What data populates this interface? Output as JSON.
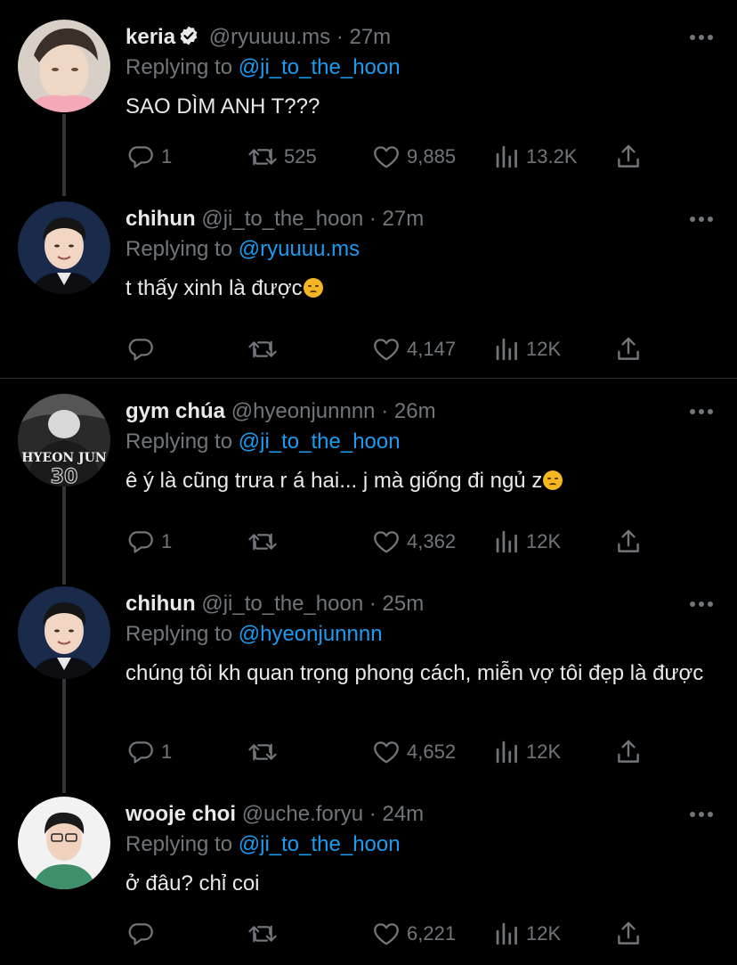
{
  "tweets": [
    {
      "name": "keria",
      "verified": true,
      "handle": "@ryuuuu.ms",
      "time": "27m",
      "replying_prefix": "Replying to",
      "replying_to": "@ji_to_the_hoon",
      "text": "SAO DÌM ANH T???",
      "replies": "1",
      "retweets": "525",
      "likes": "9,885",
      "views": "13.2K"
    },
    {
      "name": "chihun",
      "handle": "@ji_to_the_hoon",
      "time": "27m",
      "replying_prefix": "Replying to",
      "replying_to": "@ryuuuu.ms",
      "text": "t thấy xinh là được",
      "emoji": "pensive-face",
      "replies": "",
      "retweets": "",
      "likes": "4,147",
      "views": "12K"
    },
    {
      "name": "gym chúa",
      "handle": "@hyeonjunnnn",
      "time": "26m",
      "replying_prefix": "Replying to",
      "replying_to": "@ji_to_the_hoon",
      "text": "ê ý là cũng trưa r á hai... j mà giống đi ngủ z",
      "emoji": "disappointed-face",
      "avatar_text": "HYEON JUN",
      "replies": "1",
      "retweets": "",
      "likes": "4,362",
      "views": "12K"
    },
    {
      "name": "chihun",
      "handle": "@ji_to_the_hoon",
      "time": "25m",
      "replying_prefix": "Replying to",
      "replying_to": "@hyeonjunnnn",
      "text": "chúng tôi kh quan trọng phong cách, miễn vợ tôi đẹp là được",
      "replies": "1",
      "retweets": "",
      "likes": "4,652",
      "views": "12K"
    },
    {
      "name": "wooje choi",
      "handle": "@uche.foryu",
      "time": "24m",
      "replying_prefix": "Replying to",
      "replying_to": "@ji_to_the_hoon",
      "text": "ở đâu? chỉ coi",
      "replies": "",
      "retweets": "",
      "likes": "6,221",
      "views": "12K"
    }
  ],
  "colors": {
    "background": "#000000",
    "text": "#e7e9ea",
    "muted": "#71767b",
    "link": "#1d9bf0",
    "divider": "#2f3336"
  }
}
